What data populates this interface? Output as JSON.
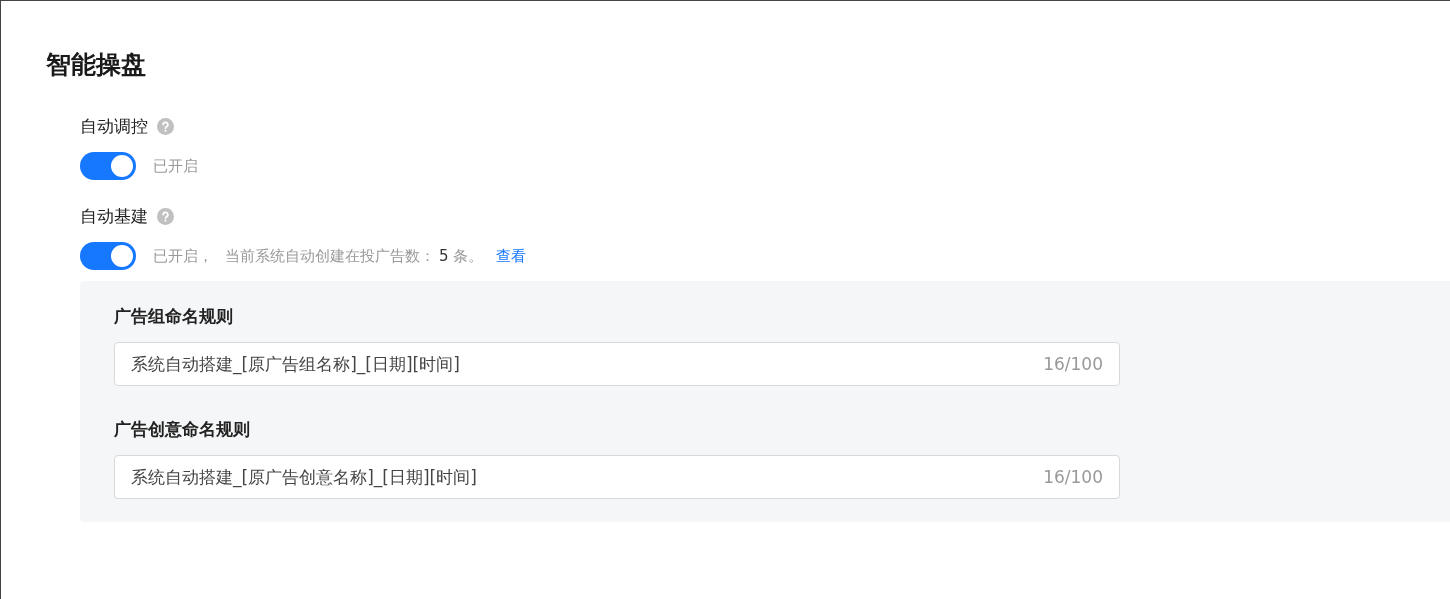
{
  "title": "智能操盘",
  "sections": [
    {
      "label": "自动调控",
      "help": true,
      "toggle": {
        "on": true
      },
      "status": "已开启"
    },
    {
      "label": "自动基建",
      "help": true,
      "toggle": {
        "on": true
      },
      "status": "已开启，",
      "info": {
        "prefix": "当前系统自动创建在投广告数：",
        "count": "5",
        "suffix": "条。",
        "link": "查看"
      },
      "fields": [
        {
          "label": "广告组命名规则",
          "value": "系统自动搭建_[原广告组名称]_[日期][时间]",
          "counter": "16/100"
        },
        {
          "label": "广告创意命名规则",
          "value": "系统自动搭建_[原广告创意名称]_[日期][时间]",
          "counter": "16/100"
        }
      ]
    }
  ]
}
